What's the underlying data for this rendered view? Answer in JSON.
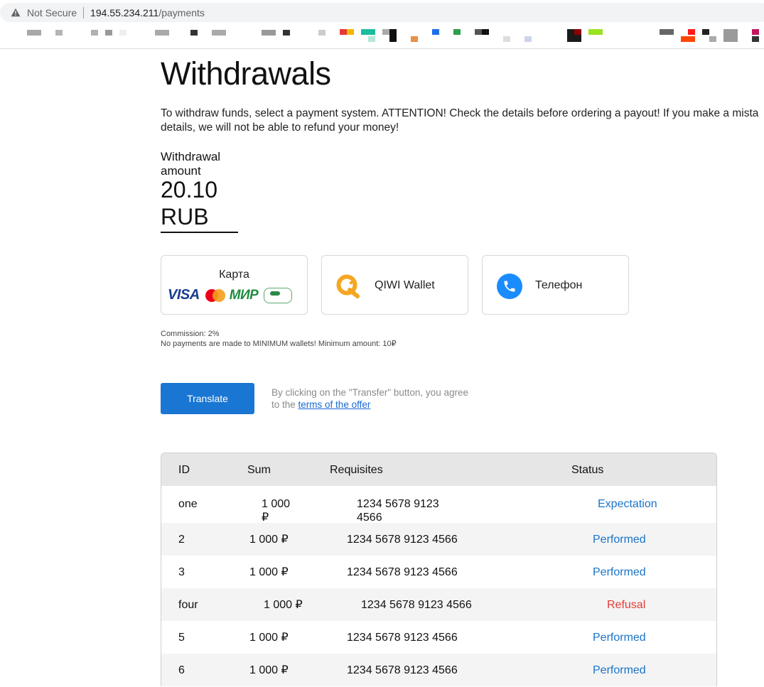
{
  "browser": {
    "security_label": "Not Secure",
    "url_host": "194.55.234.211",
    "url_path": "/payments"
  },
  "page": {
    "title": "Withdrawals",
    "notice_line1": "To withdraw funds, select a payment system. ATTENTION! Check the details before ordering a payout! If you make a mista",
    "notice_line2": "details, we will not be able to refund your money!",
    "amount_label": "Withdrawal amount",
    "amount_value": "20.10",
    "amount_currency": "RUB"
  },
  "methods": [
    {
      "label": "Карта",
      "logos": [
        "VISA",
        "МИР"
      ]
    },
    {
      "label": "QIWI Wallet",
      "icon": "qiwi-icon"
    },
    {
      "label": "Телефон",
      "icon": "phone-icon"
    }
  ],
  "commission": {
    "line1": "Commission: 2%",
    "line2": "No payments are made to MINIMUM wallets! Minimum amount: 10₽"
  },
  "action": {
    "button_label": "Translate",
    "agree_line1": "By clicking on the \"Transfer\" button, you agree",
    "agree_prefix": "to the",
    "agree_link": "terms of the offer"
  },
  "table": {
    "headers": [
      "ID",
      "Sum",
      "Requisites",
      "Status"
    ],
    "rows": [
      {
        "id": "one",
        "sum": "1 000\n₽",
        "requisites": "1234 5678 9123\n4566",
        "status": "Expectation",
        "status_color": "#1a73c8"
      },
      {
        "id": "2",
        "sum": "1 000 ₽",
        "requisites": "1234 5678 9123 4566",
        "status": "Performed",
        "status_color": "#1a73c8"
      },
      {
        "id": "3",
        "sum": "1 000 ₽",
        "requisites": "1234 5678 9123 4566",
        "status": "Performed",
        "status_color": "#1a73c8"
      },
      {
        "id": "four",
        "sum": "1 000 ₽",
        "requisites": "1234 5678 9123 4566",
        "status": "Refusal",
        "status_color": "#e53935"
      },
      {
        "id": "5",
        "sum": "1 000 ₽",
        "requisites": "1234 5678 9123 4566",
        "status": "Performed",
        "status_color": "#1a73c8"
      },
      {
        "id": "6",
        "sum": "1 000 ₽",
        "requisites": "1234 5678 9123 4566",
        "status": "Performed",
        "status_color": "#1a73c8"
      }
    ]
  }
}
